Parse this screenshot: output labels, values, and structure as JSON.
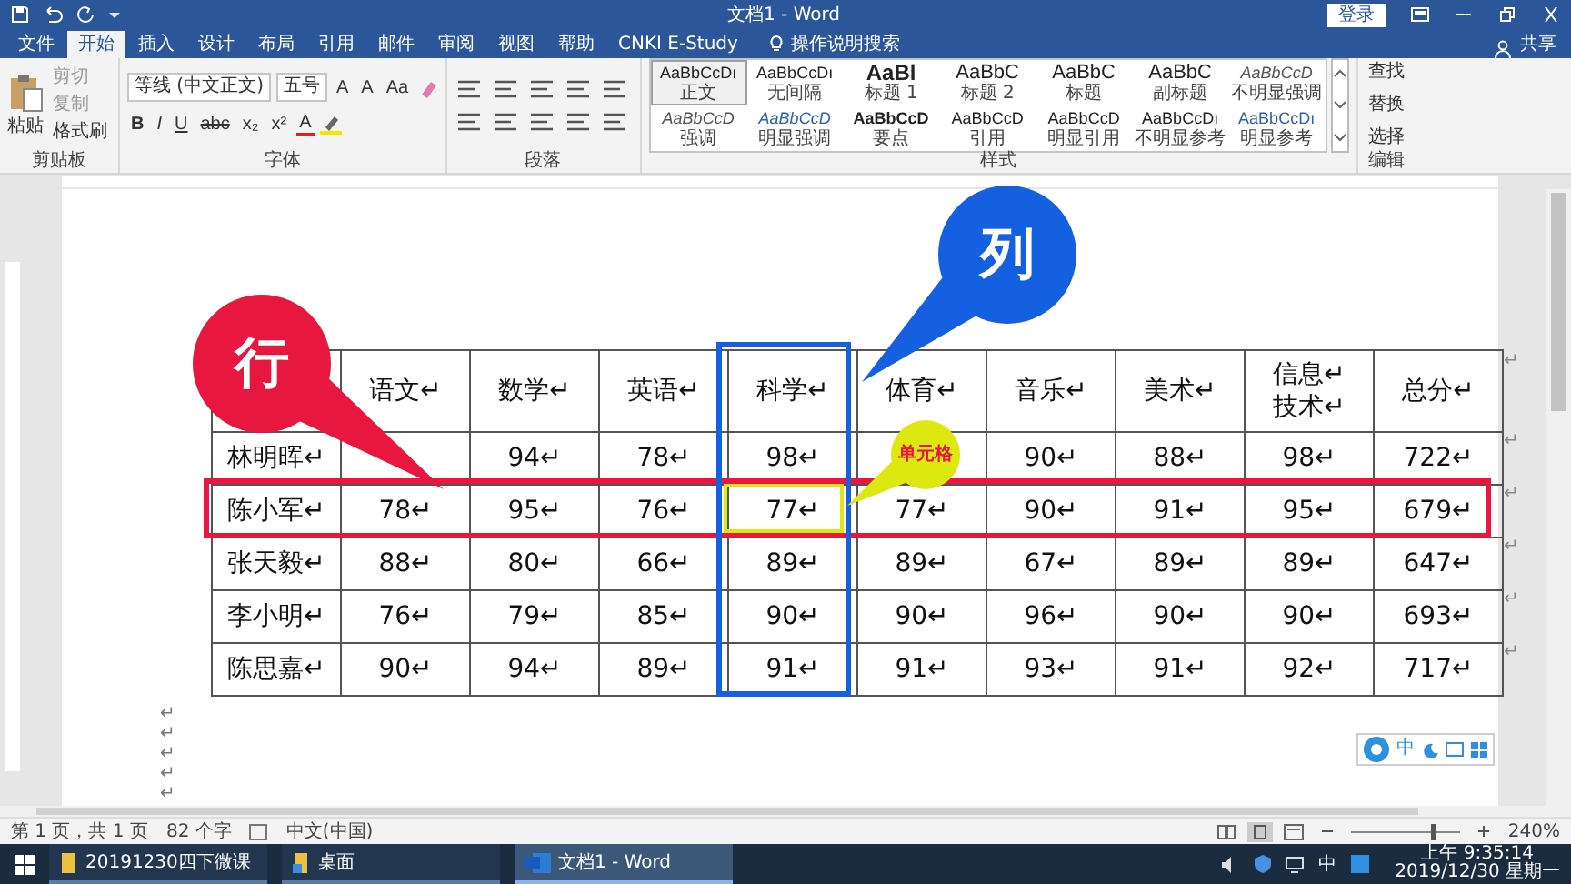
{
  "title_bar": {
    "title": "文档1 - Word",
    "login": "登录"
  },
  "menu_tabs": [
    {
      "label": "文件",
      "selected": false
    },
    {
      "label": "开始",
      "selected": true
    },
    {
      "label": "插入",
      "selected": false
    },
    {
      "label": "设计",
      "selected": false
    },
    {
      "label": "布局",
      "selected": false
    },
    {
      "label": "引用",
      "selected": false
    },
    {
      "label": "邮件",
      "selected": false
    },
    {
      "label": "审阅",
      "selected": false
    },
    {
      "label": "视图",
      "selected": false
    },
    {
      "label": "帮助",
      "selected": false
    },
    {
      "label": "CNKI E-Study",
      "selected": false
    }
  ],
  "tell_me": "操作说明搜索",
  "share": "共享",
  "ribbon": {
    "clipboard": {
      "paste": "粘贴",
      "cut": "剪切",
      "copy": "复制",
      "format_painter": "格式刷",
      "label": "剪贴板"
    },
    "font": {
      "font_name": "等线 (中文正文)",
      "font_size": "五号",
      "row1": [
        "A",
        "A",
        "Aa"
      ],
      "row2": [
        {
          "text": "B",
          "kind": "bold"
        },
        {
          "text": "I",
          "kind": "italic"
        },
        {
          "text": "U",
          "kind": "underline"
        },
        {
          "text": "abc",
          "kind": "strike"
        },
        {
          "text": "x₂",
          "kind": "plain"
        },
        {
          "text": "x²",
          "kind": "plain"
        },
        {
          "text": "A",
          "kind": "color"
        }
      ],
      "label": "字体"
    },
    "paragraph": {
      "label": "段落"
    },
    "styles": [
      {
        "sample": "AaBbCcDı",
        "name": "正文",
        "selected": true
      },
      {
        "sample": "AaBbCcDı",
        "name": "无间隔",
        "selected": false
      },
      {
        "sample": "AaBl",
        "name": "标题 1",
        "selected": false
      },
      {
        "sample": "AaBbC",
        "name": "标题 2",
        "selected": false
      },
      {
        "sample": "AaBbC",
        "name": "标题",
        "selected": false
      },
      {
        "sample": "AaBbC",
        "name": "副标题",
        "selected": false
      },
      {
        "sample": "AaBbCcD",
        "name": "不明显强调",
        "selected": false
      },
      {
        "sample": "AaBbCcD",
        "name": "强调",
        "selected": false
      },
      {
        "sample": "AaBbCcD",
        "name": "明显强调",
        "selected": false
      },
      {
        "sample": "AaBbCcD",
        "name": "要点",
        "selected": false
      },
      {
        "sample": "AaBbCcD",
        "name": "引用",
        "selected": false
      },
      {
        "sample": "AaBbCcD",
        "name": "明显引用",
        "selected": false
      },
      {
        "sample": "AaBbCcDı",
        "name": "不明显参考",
        "selected": false
      },
      {
        "sample": "AaBbCcDı",
        "name": "明显参考",
        "selected": false
      }
    ],
    "styles_label": "样式",
    "editing": {
      "find": "查找",
      "replace": "替换",
      "select": "选择",
      "label": "编辑"
    }
  },
  "table": {
    "columns": [
      "",
      "语文↵",
      "数学↵",
      "英语↵",
      "科学↵",
      "体育↵",
      "音乐↵",
      "美术↵",
      "信息↵\n技术↵",
      "总分↵"
    ],
    "header_end_mark": "↵",
    "rows": [
      {
        "cells": [
          "林明晖↵",
          null,
          "94↵",
          "78↵",
          "98↵",
          null,
          "90↵",
          "88↵",
          "98↵",
          "722↵"
        ],
        "end_mark": "↵"
      },
      {
        "cells": [
          "陈小军↵",
          "78↵",
          "95↵",
          "76↵",
          "77↵",
          "77↵",
          "90↵",
          "91↵",
          "95↵",
          "679↵"
        ],
        "end_mark": "↵"
      },
      {
        "cells": [
          "张天毅↵",
          "88↵",
          "80↵",
          "66↵",
          "89↵",
          "89↵",
          "67↵",
          "89↵",
          "89↵",
          "647↵"
        ],
        "end_mark": "↵"
      },
      {
        "cells": [
          "李小明↵",
          "76↵",
          "79↵",
          "85↵",
          "90↵",
          "90↵",
          "96↵",
          "90↵",
          "90↵",
          "693↵"
        ],
        "end_mark": "↵"
      },
      {
        "cells": [
          "陈思嘉↵",
          "90↵",
          "94↵",
          "89↵",
          "91↵",
          "91↵",
          "93↵",
          "91↵",
          "92↵",
          "717↵"
        ],
        "end_mark": "↵"
      }
    ]
  },
  "callouts": [
    {
      "kind": "row",
      "label": "行",
      "color": "#e8173f"
    },
    {
      "kind": "column",
      "label": "列",
      "color": "#1560e0"
    },
    {
      "kind": "cell",
      "label": "单元格",
      "color": "#dce80f"
    }
  ],
  "paragraph_marks": [
    "↵",
    "↵",
    "↵",
    "↵",
    "↵"
  ],
  "floating_toolbar": {
    "input_mode": "中"
  },
  "status_bar": {
    "page": "第 1 页，共 1 页",
    "words": "82 个字",
    "language": "中文(中国)",
    "zoom": {
      "level": 0.72
    },
    "zoom_text": "240%"
  },
  "taskbar": {
    "items": [
      {
        "label": "20191230四下微课",
        "kind": "folder",
        "selected": false
      },
      {
        "label": "桌面",
        "kind": "desktop",
        "selected": false
      },
      {
        "label": "文档1 - Word",
        "kind": "word",
        "selected": true
      }
    ],
    "input_mode": "中",
    "time": "上午 9:35:14",
    "date": "2019/12/30 星期一"
  }
}
